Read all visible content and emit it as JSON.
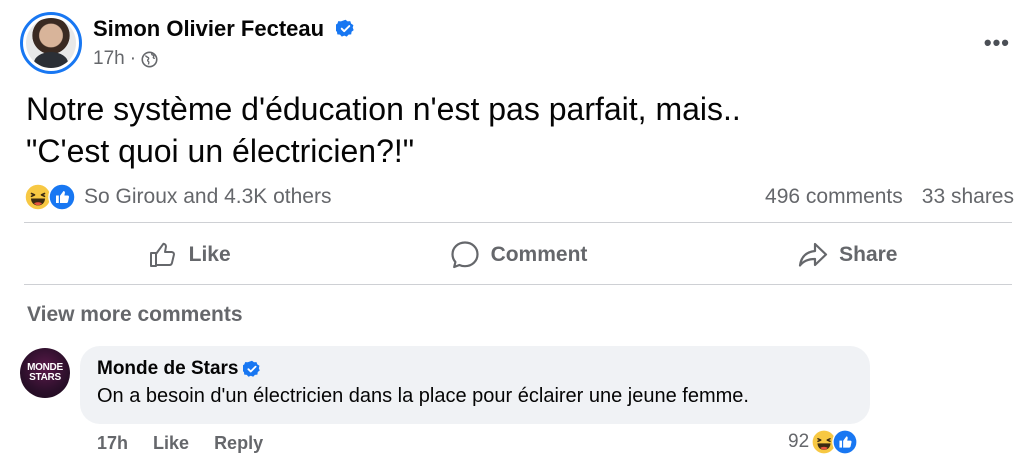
{
  "post": {
    "author": "Simon Olivier Fecteau",
    "time": "17h",
    "separator": "·",
    "text": "Notre système d'éducation n'est pas parfait, mais..\n\"C'est quoi un électricien?!\"",
    "more_icon": "more-options-icon",
    "more_label": "•••"
  },
  "reactions": {
    "names": "So Giroux and 4.3K others",
    "comments": "496 comments",
    "shares": "33 shares",
    "icons": [
      "haha-icon",
      "like-icon"
    ]
  },
  "actions": {
    "like": "Like",
    "comment": "Comment",
    "share": "Share"
  },
  "view_more": "View more comments",
  "comment": {
    "avatar_text": "MONDE STARS",
    "author": "Monde de Stars",
    "text": "On a besoin d'un électricien dans la place pour éclairer une jeune femme.",
    "time": "17h",
    "like": "Like",
    "reply": "Reply",
    "reaction_count": "92"
  },
  "colors": {
    "accent": "#1877f2",
    "secondary_text": "#65676b",
    "bubble": "#f0f2f5",
    "divider": "#ced0d4"
  }
}
